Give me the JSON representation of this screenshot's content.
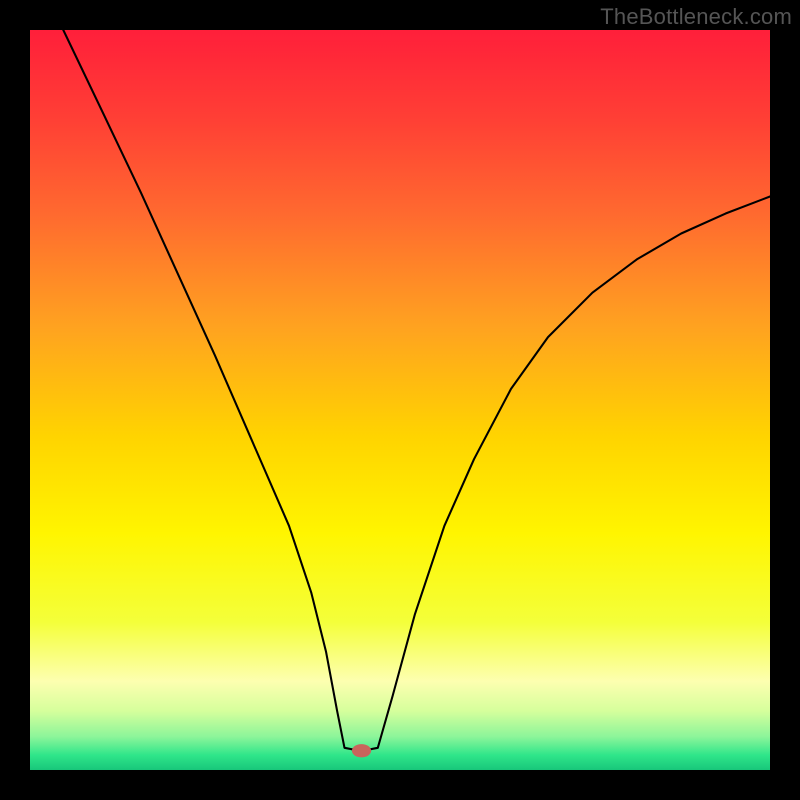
{
  "watermark": "TheBottleneck.com",
  "chart_data": {
    "type": "line",
    "title": "",
    "xlabel": "",
    "ylabel": "",
    "xlim": [
      0,
      100
    ],
    "ylim": [
      0,
      100
    ],
    "background_gradient": {
      "stops": [
        {
          "offset": 0.0,
          "color": "#ff1f3a"
        },
        {
          "offset": 0.12,
          "color": "#ff3f35"
        },
        {
          "offset": 0.25,
          "color": "#ff6a2f"
        },
        {
          "offset": 0.4,
          "color": "#ffa220"
        },
        {
          "offset": 0.55,
          "color": "#ffd400"
        },
        {
          "offset": 0.68,
          "color": "#fff500"
        },
        {
          "offset": 0.8,
          "color": "#f4ff3a"
        },
        {
          "offset": 0.88,
          "color": "#fdffb0"
        },
        {
          "offset": 0.92,
          "color": "#d6ff9c"
        },
        {
          "offset": 0.955,
          "color": "#8cf59a"
        },
        {
          "offset": 0.98,
          "color": "#2fe68a"
        },
        {
          "offset": 1.0,
          "color": "#18c67a"
        }
      ]
    },
    "series": [
      {
        "name": "left-branch",
        "x": [
          4.5,
          10,
          15,
          20,
          25,
          30,
          35,
          38,
          40,
          41.5,
          42.5
        ],
        "y": [
          100,
          88.5,
          78,
          67,
          56,
          44.5,
          33,
          24,
          16,
          8,
          3
        ]
      },
      {
        "name": "plateau",
        "x": [
          42.5,
          44,
          45.5,
          47
        ],
        "y": [
          3,
          2.7,
          2.7,
          3
        ]
      },
      {
        "name": "right-branch",
        "x": [
          47,
          49,
          52,
          56,
          60,
          65,
          70,
          76,
          82,
          88,
          94,
          100
        ],
        "y": [
          3,
          10,
          21,
          33,
          42,
          51.5,
          58.5,
          64.5,
          69,
          72.5,
          75.2,
          77.5
        ]
      }
    ],
    "marker": {
      "cx": 44.8,
      "cy": 2.6,
      "rx": 1.3,
      "ry": 0.9,
      "fill": "#c9645c"
    }
  }
}
